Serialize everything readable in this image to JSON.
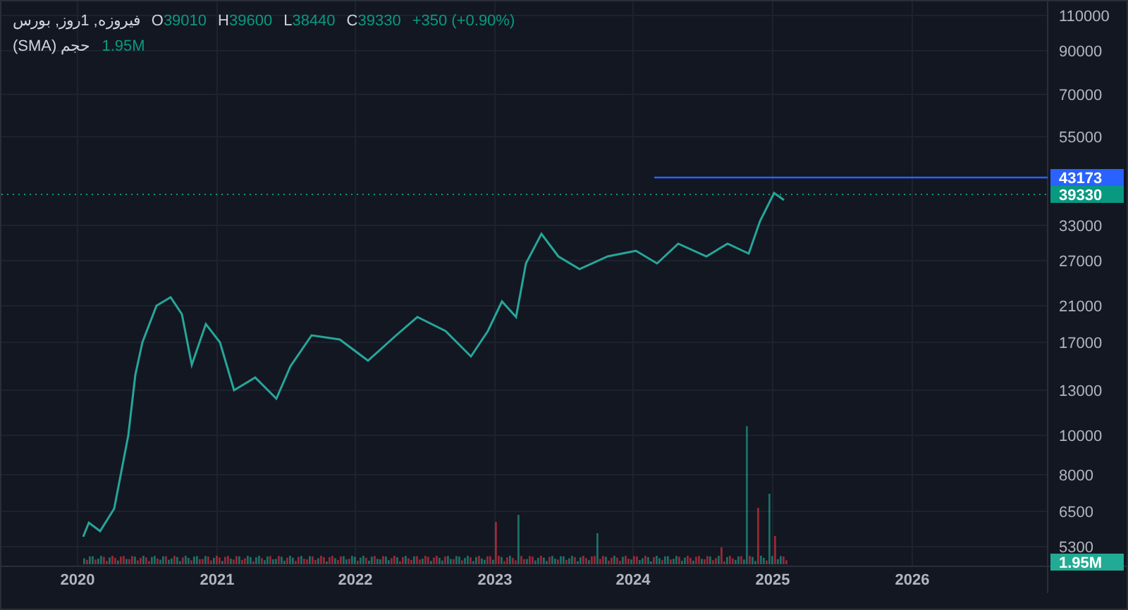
{
  "legend": {
    "symbol": "فیروزه, 1روز, بورس",
    "ohlc": [
      {
        "label": "O",
        "value": "39010"
      },
      {
        "label": "H",
        "value": "39600"
      },
      {
        "label": "L",
        "value": "38440"
      },
      {
        "label": "C",
        "value": "39330"
      }
    ],
    "change": "+350 (+0.90%)",
    "volume_name": "حجم (SMA)",
    "volume_value": "1.95M"
  },
  "chart": {
    "kind": "picture",
    "price_axis_labels": [
      "110000",
      "90000",
      "70000",
      "55000",
      "33000",
      "27000",
      "21000",
      "17000",
      "13000",
      "10000",
      "8000",
      "6500",
      "5300"
    ],
    "time_axis_labels": [
      "2020",
      "2021",
      "2022",
      "2023",
      "2024",
      "2025",
      "2026"
    ],
    "badges": [
      {
        "kind": "alert_line",
        "label": "43173",
        "color": "#2962ff"
      },
      {
        "kind": "last_price",
        "label": "39330",
        "color": "#089981"
      },
      {
        "kind": "volume",
        "label": "1.95M",
        "color": "#22ab94"
      }
    ]
  }
}
